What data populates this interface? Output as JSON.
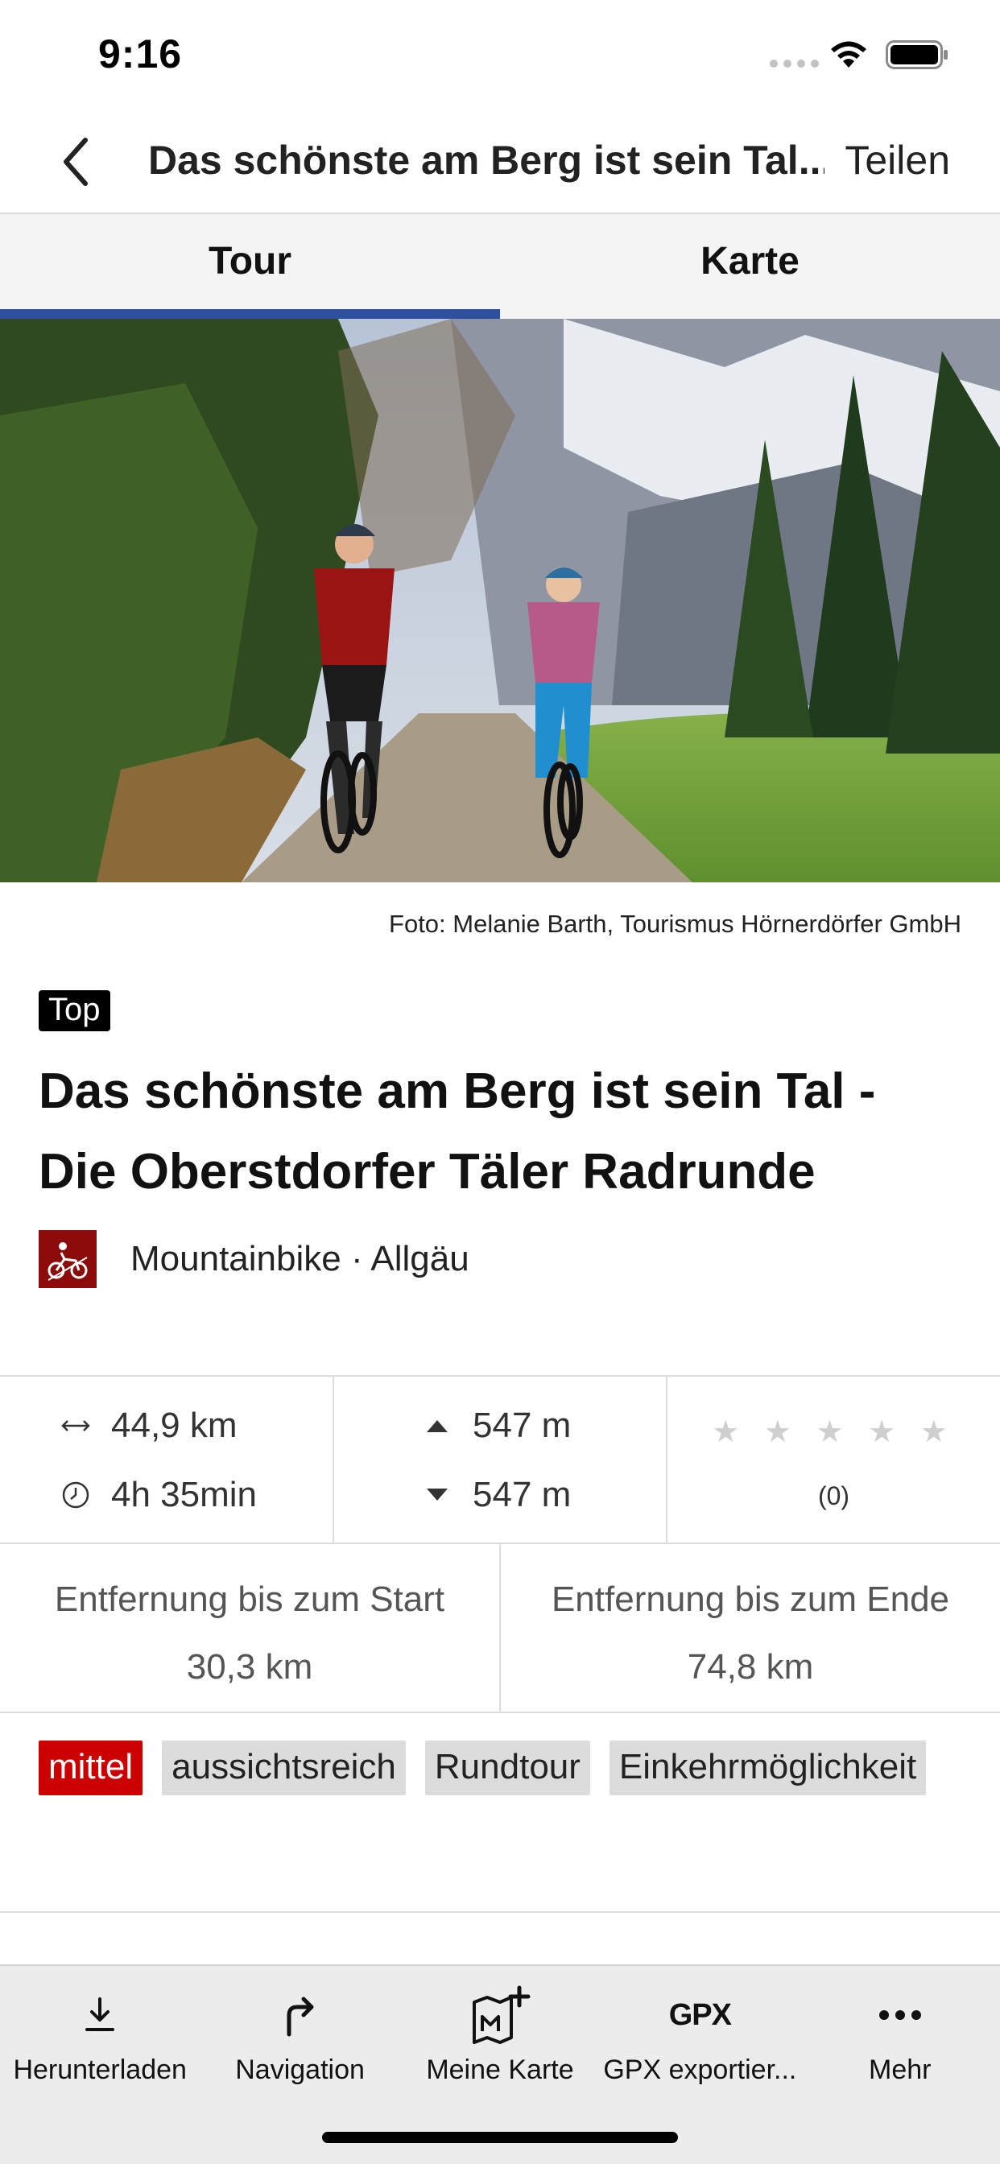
{
  "status": {
    "time": "9:16"
  },
  "nav": {
    "title": "Das schönste am Berg ist sein Tal...",
    "share_label": "Teilen"
  },
  "tabs": [
    {
      "label": "Tour",
      "active": true
    },
    {
      "label": "Karte",
      "active": false
    }
  ],
  "photo": {
    "credit": "Foto: Melanie Barth, Tourismus Hörnerdörfer GmbH"
  },
  "tour": {
    "badge": "Top",
    "title": "Das schönste am Berg ist sein Tal - Die Oberstdorfer Täler Radrunde",
    "category": "Mountainbike · Allgäu",
    "category_icon": "mountainbike-icon"
  },
  "stats": {
    "distance": "44,9 km",
    "duration": "4h 35min",
    "ascent": "547 m",
    "descent": "547 m",
    "stars": "★ ★ ★ ★ ★",
    "rating_count": "(0)",
    "rating_value": 0,
    "dist_start_label": "Entfernung bis zum Start",
    "dist_start_value": "30,3 km",
    "dist_end_label": "Entfernung bis zum Ende",
    "dist_end_value": "74,8 km"
  },
  "tags": {
    "difficulty": "mittel",
    "items": [
      "aussichtsreich",
      "Rundtour",
      "Einkehrmöglichkeit"
    ]
  },
  "toolbar": [
    {
      "label": "Herunterladen",
      "icon": "download-icon"
    },
    {
      "label": "Navigation",
      "icon": "turn-right-arrow-icon"
    },
    {
      "label": "Meine Karte",
      "icon": "map-add-icon"
    },
    {
      "label": "GPX exportier...",
      "icon": "gpx-icon",
      "icon_text": "GPX"
    },
    {
      "label": "Mehr",
      "icon": "more-dots-icon"
    }
  ],
  "colors": {
    "accent": "#2c4fa0",
    "difficulty": "#cc0000",
    "category_icon_bg": "#8b0b0b"
  }
}
